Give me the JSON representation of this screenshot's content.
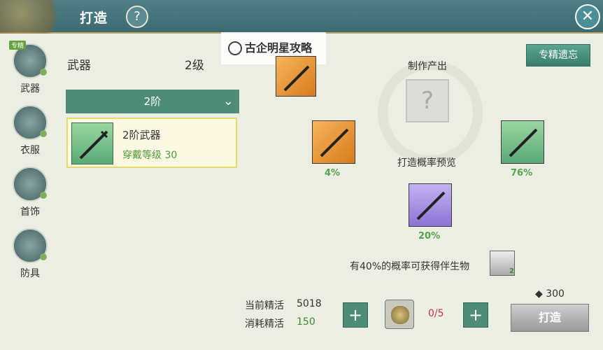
{
  "window": {
    "title": "打造",
    "help": "?",
    "close": "✕"
  },
  "tabs": [
    {
      "label": "武器",
      "tag": "专精"
    },
    {
      "label": "衣服"
    },
    {
      "label": "首饰"
    },
    {
      "label": "防具"
    }
  ],
  "category": {
    "name": "武器",
    "level": "2级"
  },
  "tier_dropdown": {
    "value": "2阶"
  },
  "item": {
    "name": "2阶武器",
    "requirement": "穿戴等级 30"
  },
  "watermark": {
    "text": "古企明星攻略"
  },
  "expert_button": "专精遗忘",
  "output": {
    "label": "制作产出",
    "unknown": "?",
    "preview_label": "打造概率预览"
  },
  "outcomes": [
    {
      "rarity": "orange",
      "percent": "4%"
    },
    {
      "rarity": "green",
      "percent": "76%"
    },
    {
      "rarity": "purple",
      "percent": "20%"
    }
  ],
  "bonus_text": "有40%的概率可获得伴生物",
  "bonus_item_count": "2",
  "currency": {
    "amount": "300"
  },
  "stats": {
    "current_label": "当前精活",
    "current_value": "5018",
    "cost_label": "消耗精活",
    "cost_value": "150"
  },
  "material": {
    "count": "0/5"
  },
  "forge_button": "打造",
  "colors": {
    "accent": "#4f8c77",
    "success": "#56a54e",
    "warning": "#c0393b"
  }
}
